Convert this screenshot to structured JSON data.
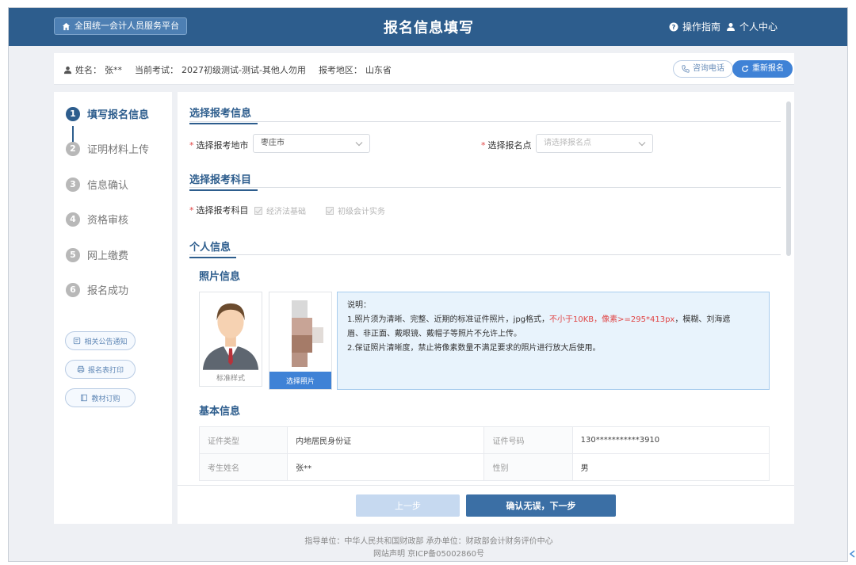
{
  "header": {
    "home_label": "全国统一会计人员服务平台",
    "title": "报名信息填写",
    "guide_label": "操作指南",
    "personal_label": "个人中心"
  },
  "userbar": {
    "name_label": "姓名：",
    "name_value": "张**",
    "exam_label": "当前考试：",
    "exam_value": "2027初级测试-测试-其他人勿用",
    "region_label": "报考地区：",
    "region_value": "山东省",
    "consult_label": "咨询电话",
    "reapply_label": "重新报名"
  },
  "steps": [
    {
      "num": "1",
      "label": "填写报名信息",
      "active": true
    },
    {
      "num": "2",
      "label": "证明材料上传",
      "active": false
    },
    {
      "num": "3",
      "label": "信息确认",
      "active": false
    },
    {
      "num": "4",
      "label": "资格审核",
      "active": false
    },
    {
      "num": "5",
      "label": "网上缴费",
      "active": false
    },
    {
      "num": "6",
      "label": "报名成功",
      "active": false
    }
  ],
  "side_buttons": [
    "相关公告通知",
    "报名表打印",
    "教材订购"
  ],
  "section_exam_info": {
    "title": "选择报考信息",
    "city_label": "选择报考地市",
    "city_value": "枣庄市",
    "point_label": "选择报名点",
    "point_placeholder": "请选择报名点"
  },
  "section_subjects": {
    "title": "选择报考科目",
    "label": "选择报考科目",
    "subjects": [
      "经济法基础",
      "初级会计实务"
    ]
  },
  "section_personal": {
    "title": "个人信息",
    "photo_title": "照片信息",
    "sample_caption": "标准样式",
    "choose_photo": "选择照片",
    "note_title": "说明：",
    "note_line1_a": "1.照片须为清晰、完整、近期的标准证件照片，jpg格式，",
    "note_line1_red": "不小于10KB，像素>=295*413px",
    "note_line1_b": "，模糊、刘海遮",
    "note_line1_c": "眉、非正面、戴眼镜、戴帽子等照片不允许上传。",
    "note_line2": "2.保证照片清晰度，禁止将像素数量不满足要求的照片进行放大后使用。",
    "basic_title": "基本信息"
  },
  "basic_info": {
    "rows": [
      {
        "k1": "证件类型",
        "v1": "内地居民身份证",
        "k2": "证件号码",
        "v2": "130***********3910"
      },
      {
        "k1": "考生姓名",
        "v1": "张**",
        "k2": "性别",
        "v2": "男"
      }
    ]
  },
  "actions": {
    "prev": "上一步",
    "next": "确认无误，下一步"
  },
  "footer": {
    "line1": "指导单位：中华人民共和国财政部    承办单位：财政部会计财务评价中心",
    "line2": "网站声明    京ICP备05002860号"
  },
  "colors": {
    "header_bg": "#2d5d8d",
    "accent": "#3f82d6",
    "required": "#e04545",
    "note_bg": "#e8f3fc"
  }
}
